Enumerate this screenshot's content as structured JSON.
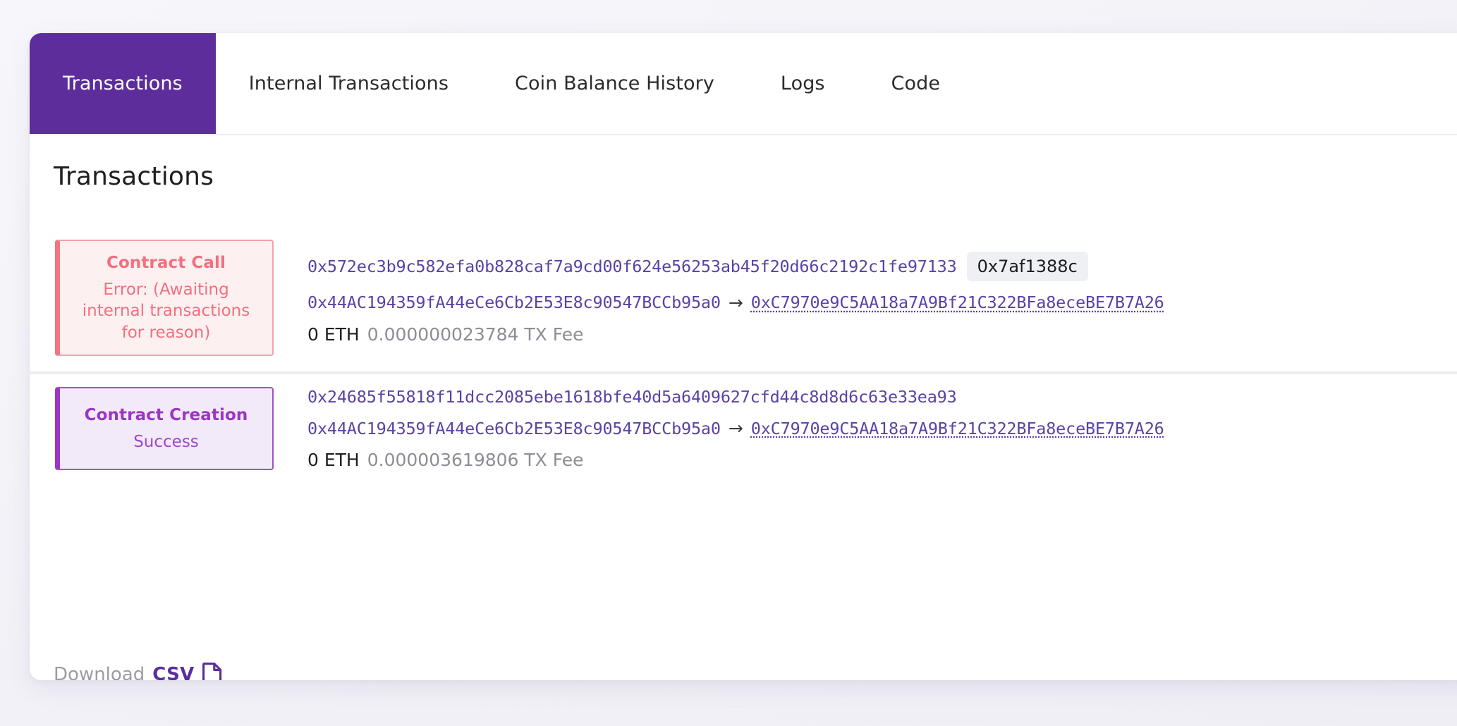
{
  "tabs": [
    {
      "label": "Transactions",
      "active": true
    },
    {
      "label": "Internal Transactions",
      "active": false
    },
    {
      "label": "Coin Balance History",
      "active": false
    },
    {
      "label": "Logs",
      "active": false
    },
    {
      "label": "Code",
      "active": false
    }
  ],
  "main": {
    "section_title": "Transactions"
  },
  "transactions": [
    {
      "type": "Contract Call",
      "status": "Error: (Awaiting internal transactions for reason)",
      "state": "error",
      "hash": "0x572ec3b9c582efa0b828caf7a9cd00f624e56253ab45f20d66c2192c1fe97133",
      "chip": "0x7af1388c",
      "from": "0x44AC194359fA44eCe6Cb2E53E8c90547BCCb95a0",
      "arrow": "→",
      "to": "0xC7970e9C5AA18a7A9Bf21C322BFa8eceBE7B7A26",
      "value": "0 ETH",
      "fee": "0.000000023784 TX Fee"
    },
    {
      "type": "Contract Creation",
      "status": "Success",
      "state": "success",
      "hash": "0x24685f55818f11dcc2085ebe1618bfe40d5a6409627cfd44c8d8d6c63e33ea93",
      "chip": "",
      "from": "0x44AC194359fA44eCe6Cb2E53E8c90547BCCb95a0",
      "arrow": "→",
      "to": "0xC7970e9C5AA18a7A9Bf21C322BFa8eceBE7B7A26",
      "value": "0 ETH",
      "fee": "0.000003619806 TX Fee"
    }
  ],
  "footer": {
    "download_label": "Download",
    "csv_label": "CSV",
    "file_icon": "file-icon"
  },
  "colors": {
    "brand_purple": "#5c2d9b",
    "error_red": "#f2707f",
    "success_purple": "#9b36c4",
    "hash_purple": "#5a42a6"
  }
}
